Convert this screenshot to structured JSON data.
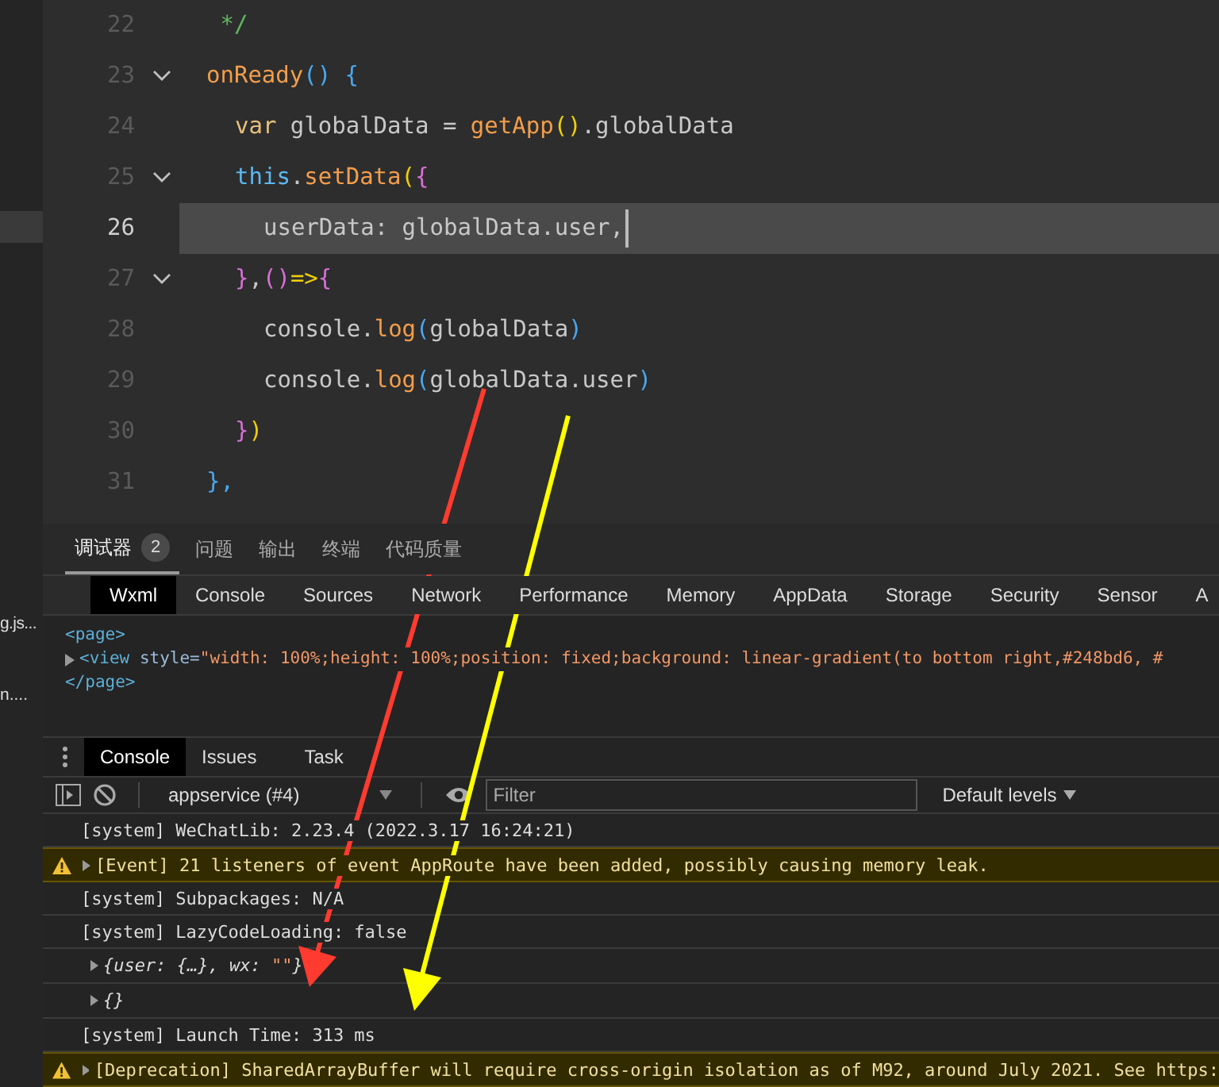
{
  "sidebar": {
    "items": [
      {
        "selected": true
      },
      {
        "label": "g.js...",
        "selected": false
      },
      {
        "label": "n....",
        "selected": false
      }
    ]
  },
  "editor": {
    "lines": [
      {
        "number": "22",
        "fold": false,
        "active": false,
        "tokens": [
          {
            "text": " */",
            "kind": "comment"
          }
        ]
      },
      {
        "number": "23",
        "fold": true,
        "active": false,
        "tokens": [
          {
            "text": "onReady",
            "kind": "fn"
          },
          {
            "text": "() {",
            "kind": "p3"
          }
        ],
        "children": [
          {
            "number": "24",
            "fold": false,
            "active": false,
            "tokens": [
              {
                "text": "var",
                "kind": "kw"
              },
              {
                "text": " globalData = ",
                "kind": "plain"
              },
              {
                "text": "getApp",
                "kind": "fn"
              },
              {
                "text": "()",
                "kind": "p1"
              },
              {
                "text": ".globalData",
                "kind": "plain"
              }
            ]
          },
          {
            "number": "25",
            "fold": true,
            "active": false,
            "tokens": [
              {
                "text": "this",
                "kind": "this"
              },
              {
                "text": ".",
                "kind": "plain"
              },
              {
                "text": "setData",
                "kind": "fn"
              },
              {
                "text": "(",
                "kind": "p1"
              },
              {
                "text": "{",
                "kind": "p2"
              }
            ],
            "children": [
              {
                "number": "26",
                "fold": false,
                "active": true,
                "tokens": [
                  {
                    "text": "userData: globalData.user,",
                    "kind": "plain"
                  }
                ]
              }
            ]
          },
          {
            "number": "27",
            "fold": true,
            "active": false,
            "tokens": [
              {
                "text": "}",
                "kind": "p2"
              },
              {
                "text": ",",
                "kind": "plain"
              },
              {
                "text": "()",
                "kind": "p2"
              },
              {
                "text": "=>",
                "kind": "p1"
              },
              {
                "text": "{",
                "kind": "p2"
              }
            ],
            "children": [
              {
                "number": "28",
                "fold": false,
                "active": false,
                "tokens": [
                  {
                    "text": "console.",
                    "kind": "plain"
                  },
                  {
                    "text": "log",
                    "kind": "fn"
                  },
                  {
                    "text": "(",
                    "kind": "p3"
                  },
                  {
                    "text": "globalData",
                    "kind": "plain"
                  },
                  {
                    "text": ")",
                    "kind": "p3"
                  }
                ]
              },
              {
                "number": "29",
                "fold": false,
                "active": false,
                "tokens": [
                  {
                    "text": "console.",
                    "kind": "plain"
                  },
                  {
                    "text": "log",
                    "kind": "fn"
                  },
                  {
                    "text": "(",
                    "kind": "p3"
                  },
                  {
                    "text": "globalData.user",
                    "kind": "plain"
                  },
                  {
                    "text": ")",
                    "kind": "p3"
                  }
                ]
              }
            ]
          },
          {
            "number": "30",
            "fold": false,
            "active": false,
            "tokens": [
              {
                "text": "}",
                "kind": "p2"
              },
              {
                "text": ")",
                "kind": "p1"
              }
            ]
          }
        ]
      },
      {
        "number": "31",
        "fold": false,
        "active": false,
        "tokens": [
          {
            "text": "},",
            "kind": "p3"
          }
        ]
      }
    ]
  },
  "panel_tabs": [
    {
      "label": "调试器",
      "badge": "2",
      "selected": true
    },
    {
      "label": "问题",
      "selected": false
    },
    {
      "label": "输出",
      "selected": false
    },
    {
      "label": "终端",
      "selected": false
    },
    {
      "label": "代码质量",
      "selected": false
    }
  ],
  "devtools_tabs": [
    {
      "label": "Wxml",
      "selected": true
    },
    {
      "label": "Console",
      "selected": false
    },
    {
      "label": "Sources",
      "selected": false
    },
    {
      "label": "Network",
      "selected": false
    },
    {
      "label": "Performance",
      "selected": false
    },
    {
      "label": "Memory",
      "selected": false
    },
    {
      "label": "AppData",
      "selected": false
    },
    {
      "label": "Storage",
      "selected": false
    },
    {
      "label": "Security",
      "selected": false
    },
    {
      "label": "Sensor",
      "selected": false
    },
    {
      "label": "A",
      "selected": false
    }
  ],
  "wxml_tree": [
    {
      "kind": "tag",
      "text": "<page>",
      "expandable": false
    },
    {
      "kind": "view",
      "expandable": true,
      "tag": "<view",
      "attr": "style=",
      "value": "\"width: 100%;height: 100%;position: fixed;background: linear-gradient(to bottom right,#248bd6, #"
    },
    {
      "kind": "tag",
      "text": "</page>",
      "expandable": false
    }
  ],
  "drawer_tabs": [
    {
      "label": "Console",
      "selected": true
    },
    {
      "label": "Issues",
      "selected": false
    },
    {
      "label": "Task",
      "selected": false
    }
  ],
  "console_toolbar": {
    "context": "appservice (#4)",
    "filter_placeholder": "Filter",
    "levels": "Default levels"
  },
  "messages": [
    {
      "kind": "system",
      "text": "[system] WeChatLib: 2.23.4 (2022.3.17 16:24:21)"
    },
    {
      "kind": "warning",
      "text": "[Event] 21 listeners of event AppRoute have been added, possibly causing memory leak."
    },
    {
      "kind": "system",
      "text": "[system] Subpackages: N/A"
    },
    {
      "kind": "system",
      "text": "[system] LazyCodeLoading: false"
    },
    {
      "kind": "object",
      "parts": [
        {
          "text": "{user: {…}, wx: ",
          "kind": "plain"
        },
        {
          "text": "\"\"",
          "kind": "string"
        },
        {
          "text": "}",
          "kind": "plain"
        }
      ]
    },
    {
      "kind": "object",
      "parts": [
        {
          "text": "{}",
          "kind": "plain"
        }
      ]
    },
    {
      "kind": "system",
      "text": "[system] Launch Time: 313 ms"
    },
    {
      "kind": "warning",
      "text": "[Deprecation] SharedArrayBuffer will require cross-origin isolation as of M92, around July 2021. See https:"
    }
  ]
}
